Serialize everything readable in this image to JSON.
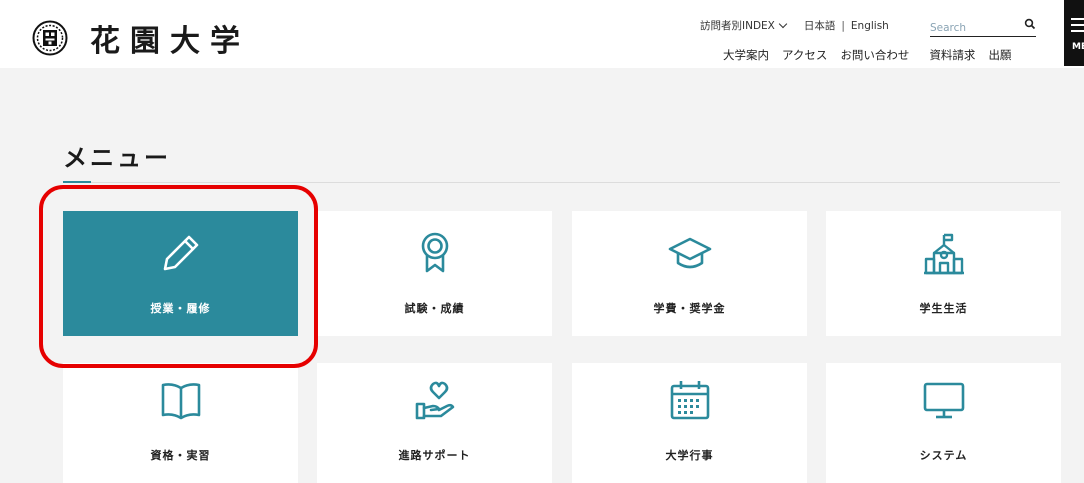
{
  "header": {
    "logo_text": "花園大学",
    "utility": {
      "index_label": "訪問者別INDEX",
      "lang_ja": "日本語",
      "lang_sep": "|",
      "lang_en": "English"
    },
    "search": {
      "placeholder": "Search",
      "value": ""
    },
    "nav": [
      "大学案内",
      "アクセス",
      "お問い合わせ",
      "資料請求",
      "出願"
    ],
    "menu_button_label": "MENU"
  },
  "main": {
    "title": "メニュー",
    "tiles": [
      {
        "label": "授業・履修",
        "icon": "pencil-icon",
        "active": true
      },
      {
        "label": "試験・成績",
        "icon": "award-ribbon-icon",
        "active": false
      },
      {
        "label": "学費・奨学金",
        "icon": "graduation-cap-icon",
        "active": false
      },
      {
        "label": "学生生活",
        "icon": "school-building-icon",
        "active": false
      },
      {
        "label": "資格・実習",
        "icon": "open-book-icon",
        "active": false
      },
      {
        "label": "進路サポート",
        "icon": "hand-heart-icon",
        "active": false
      },
      {
        "label": "大学行事",
        "icon": "calendar-icon",
        "active": false
      },
      {
        "label": "システム",
        "icon": "monitor-icon",
        "active": false
      }
    ]
  },
  "colors": {
    "accent": "#2b8a9c",
    "highlight": "#e60000",
    "background": "#f3f3f3"
  }
}
